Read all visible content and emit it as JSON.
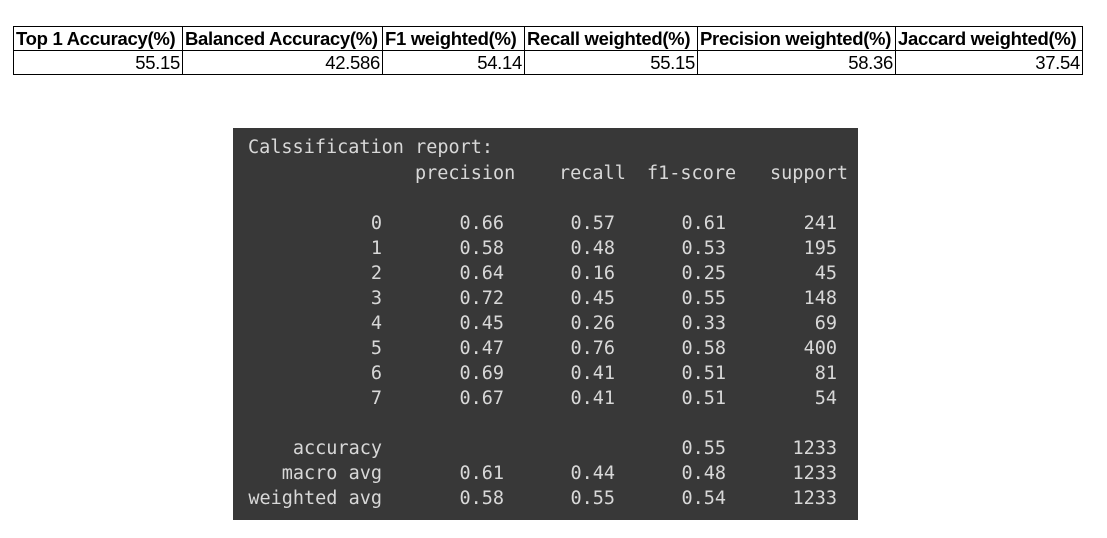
{
  "metrics_table": {
    "headers": [
      "Top 1 Accuracy(%)",
      "Balanced Accuracy(%)",
      "F1 weighted(%)",
      "Recall weighted(%)",
      "Precision weighted(%)",
      "Jaccard weighted(%)"
    ],
    "values": [
      "55.15",
      "42.586",
      "54.14",
      "55.15",
      "58.36",
      "37.54"
    ]
  },
  "report": {
    "title": "Calssification report:",
    "columns": [
      "precision",
      "recall",
      "f1-score",
      "support"
    ],
    "class_rows": [
      {
        "label": "0",
        "precision": "0.66",
        "recall": "0.57",
        "f1": "0.61",
        "support": "241"
      },
      {
        "label": "1",
        "precision": "0.58",
        "recall": "0.48",
        "f1": "0.53",
        "support": "195"
      },
      {
        "label": "2",
        "precision": "0.64",
        "recall": "0.16",
        "f1": "0.25",
        "support": "45"
      },
      {
        "label": "3",
        "precision": "0.72",
        "recall": "0.45",
        "f1": "0.55",
        "support": "148"
      },
      {
        "label": "4",
        "precision": "0.45",
        "recall": "0.26",
        "f1": "0.33",
        "support": "69"
      },
      {
        "label": "5",
        "precision": "0.47",
        "recall": "0.76",
        "f1": "0.58",
        "support": "400"
      },
      {
        "label": "6",
        "precision": "0.69",
        "recall": "0.41",
        "f1": "0.51",
        "support": "81"
      },
      {
        "label": "7",
        "precision": "0.67",
        "recall": "0.41",
        "f1": "0.51",
        "support": "54"
      }
    ],
    "summary_rows": [
      {
        "label": "accuracy",
        "precision": "",
        "recall": "",
        "f1": "0.55",
        "support": "1233"
      },
      {
        "label": "macro avg",
        "precision": "0.61",
        "recall": "0.44",
        "f1": "0.48",
        "support": "1233"
      },
      {
        "label": "weighted avg",
        "precision": "0.58",
        "recall": "0.55",
        "f1": "0.54",
        "support": "1233"
      }
    ]
  },
  "colors": {
    "panel_background": "#383838",
    "panel_text": "#d8d8d8"
  }
}
